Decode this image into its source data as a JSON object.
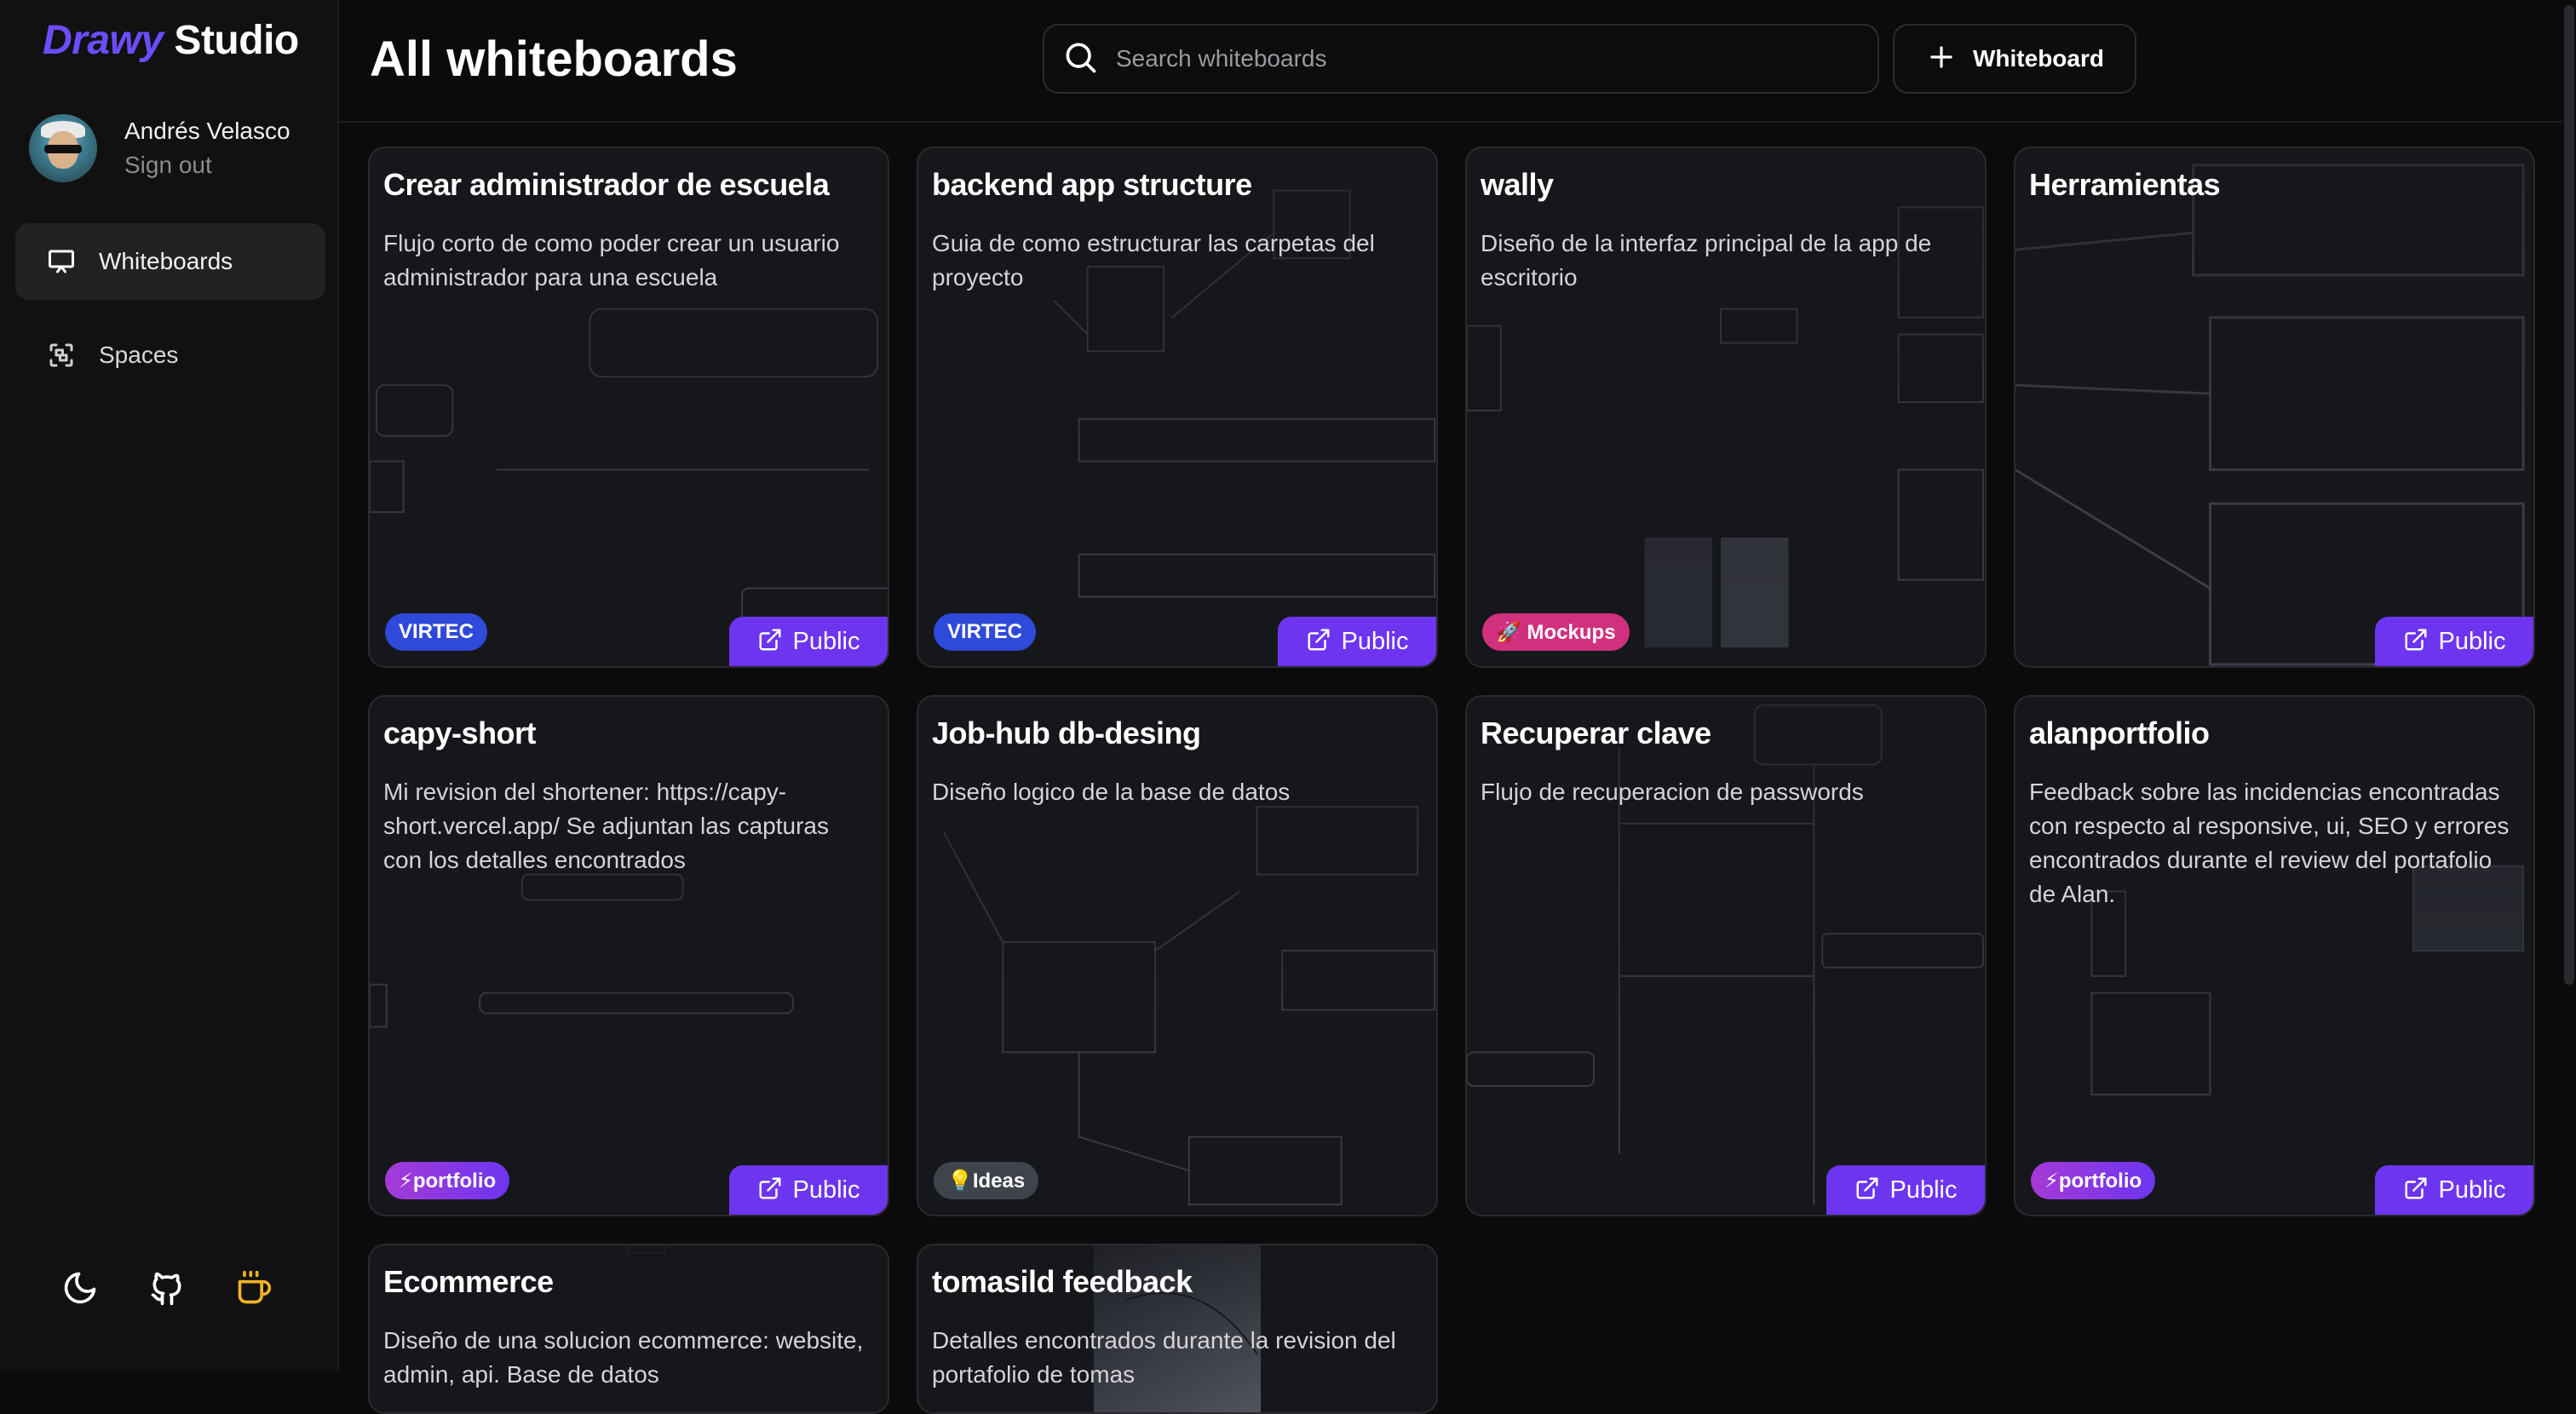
{
  "brand": {
    "part1": "Drawy",
    "part2": "Studio"
  },
  "user": {
    "name": "Andrés Velasco",
    "sign_out": "Sign out"
  },
  "nav": [
    {
      "label": "Whiteboards",
      "icon": "presentation-board-icon",
      "active": true
    },
    {
      "label": "Spaces",
      "icon": "spaces-scan-icon",
      "active": false
    }
  ],
  "bottom_icons": [
    "moon-icon",
    "github-icon",
    "coffee-cup-icon"
  ],
  "header": {
    "title": "All whiteboards",
    "search_placeholder": "Search whiteboards",
    "new_button_label": "Whiteboard"
  },
  "colors": {
    "accent": "#6d35f0",
    "brand": "#6d4cff",
    "virtec": "#2f49d8",
    "mockups": "#d1307e",
    "ideas": "#3f434b"
  },
  "public_label": "Public",
  "cards": [
    {
      "title": "Crear administrador de escuela",
      "description": "Flujo corto de como poder crear un usuario administrador para una escuela",
      "tag": "VIRTEC",
      "tag_style": "virtec",
      "public": true
    },
    {
      "title": "backend app structure",
      "description": "Guia de como estructurar las carpetas del proyecto",
      "tag": "VIRTEC",
      "tag_style": "virtec",
      "public": true
    },
    {
      "title": "wally",
      "description": "Diseño de la interfaz principal de la app de escritorio",
      "tag": "🚀 Mockups",
      "tag_style": "mockups",
      "public": false
    },
    {
      "title": "Herramientas",
      "description": "",
      "tag": "",
      "tag_style": "",
      "public": true
    },
    {
      "title": "capy-short",
      "description": "Mi revision del shortener: https://capy-short.vercel.app/ Se adjuntan las capturas con los detalles encontrados",
      "tag": "⚡portfolio",
      "tag_style": "portfolio",
      "public": true
    },
    {
      "title": "Job-hub db-desing",
      "description": "Diseño logico de la base de datos",
      "tag": "💡Ideas",
      "tag_style": "ideas",
      "public": false
    },
    {
      "title": "Recuperar clave",
      "description": "Flujo de recuperacion de passwords",
      "tag": "",
      "tag_style": "",
      "public": true
    },
    {
      "title": "alanportfolio",
      "description": "Feedback sobre las incidencias encontradas con respecto al responsive, ui, SEO y errores encontrados durante el review del portafolio de Alan.",
      "tag": "⚡portfolio",
      "tag_style": "portfolio",
      "public": true
    },
    {
      "title": "Ecommerce",
      "description": "Diseño de una solucion ecommerce: website, admin, api. Base de datos",
      "tag": "",
      "tag_style": "",
      "public": false
    },
    {
      "title": "tomasild feedback",
      "description": "Detalles encontrados durante la revision del portafolio de tomas",
      "tag": "",
      "tag_style": "",
      "public": false
    }
  ]
}
